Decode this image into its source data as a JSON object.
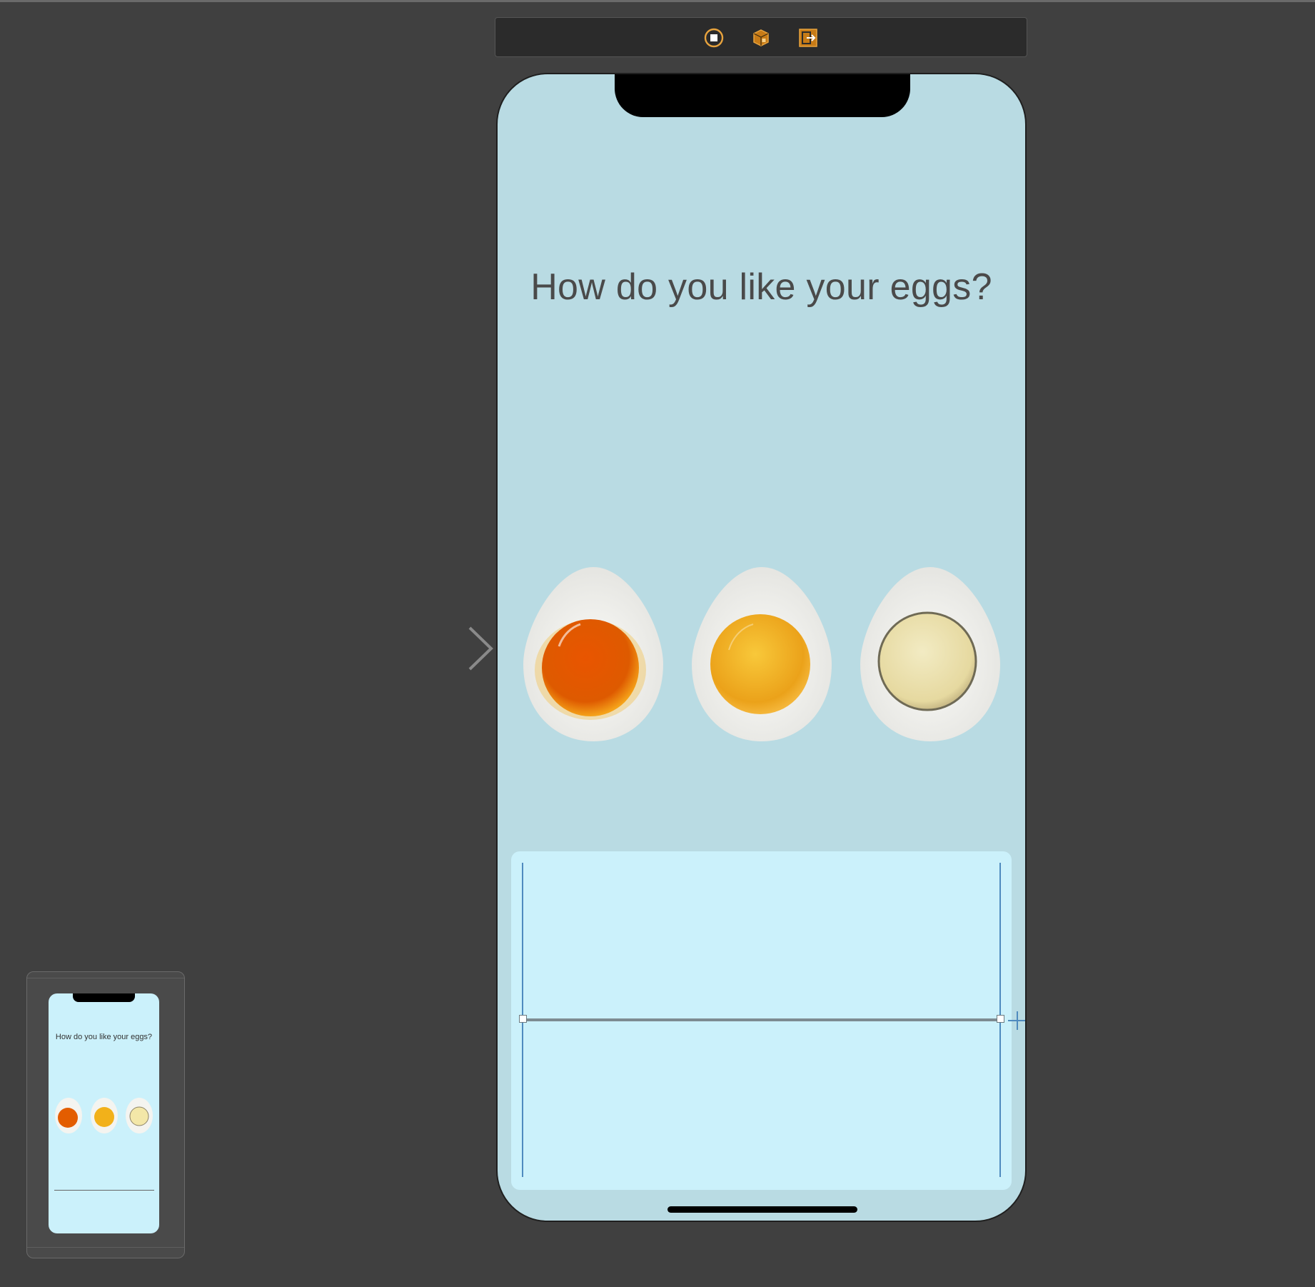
{
  "canvas": {
    "background": "#404040"
  },
  "scene_dock": {
    "icons": [
      {
        "name": "view-controller-icon",
        "color": "#e8a33d"
      },
      {
        "name": "first-responder-icon",
        "color": "#e8a33d"
      },
      {
        "name": "exit-icon",
        "color": "#e8a33d"
      }
    ]
  },
  "device": {
    "background": "#b9dbe3",
    "title_label": "How do you like your eggs?",
    "eggs": [
      {
        "name": "soft-egg",
        "yolk_color": "#e35d00"
      },
      {
        "name": "medium-egg",
        "yolk_color": "#f2b11a"
      },
      {
        "name": "hard-egg",
        "yolk_color": "#eadfa4"
      }
    ],
    "progress": 0.0,
    "bottom_area_color": "#cbf1fb"
  },
  "minimap": {
    "title_label": "How do you like your eggs?"
  }
}
